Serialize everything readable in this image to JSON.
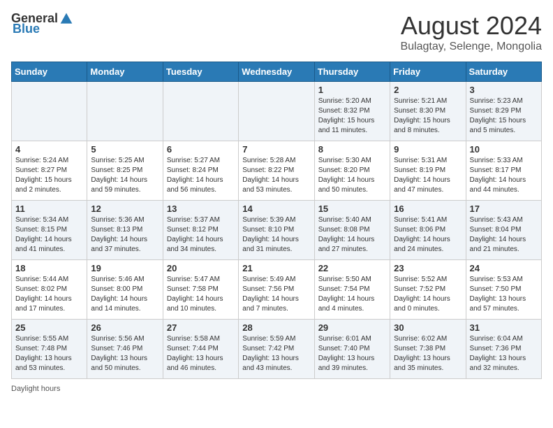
{
  "logo": {
    "general": "General",
    "blue": "Blue"
  },
  "header": {
    "month_year": "August 2024",
    "location": "Bulagtay, Selenge, Mongolia"
  },
  "days_of_week": [
    "Sunday",
    "Monday",
    "Tuesday",
    "Wednesday",
    "Thursday",
    "Friday",
    "Saturday"
  ],
  "footer": {
    "note": "Daylight hours"
  },
  "weeks": [
    {
      "days": [
        {
          "num": "",
          "info": ""
        },
        {
          "num": "",
          "info": ""
        },
        {
          "num": "",
          "info": ""
        },
        {
          "num": "",
          "info": ""
        },
        {
          "num": "1",
          "info": "Sunrise: 5:20 AM\nSunset: 8:32 PM\nDaylight: 15 hours\nand 11 minutes."
        },
        {
          "num": "2",
          "info": "Sunrise: 5:21 AM\nSunset: 8:30 PM\nDaylight: 15 hours\nand 8 minutes."
        },
        {
          "num": "3",
          "info": "Sunrise: 5:23 AM\nSunset: 8:29 PM\nDaylight: 15 hours\nand 5 minutes."
        }
      ]
    },
    {
      "days": [
        {
          "num": "4",
          "info": "Sunrise: 5:24 AM\nSunset: 8:27 PM\nDaylight: 15 hours\nand 2 minutes."
        },
        {
          "num": "5",
          "info": "Sunrise: 5:25 AM\nSunset: 8:25 PM\nDaylight: 14 hours\nand 59 minutes."
        },
        {
          "num": "6",
          "info": "Sunrise: 5:27 AM\nSunset: 8:24 PM\nDaylight: 14 hours\nand 56 minutes."
        },
        {
          "num": "7",
          "info": "Sunrise: 5:28 AM\nSunset: 8:22 PM\nDaylight: 14 hours\nand 53 minutes."
        },
        {
          "num": "8",
          "info": "Sunrise: 5:30 AM\nSunset: 8:20 PM\nDaylight: 14 hours\nand 50 minutes."
        },
        {
          "num": "9",
          "info": "Sunrise: 5:31 AM\nSunset: 8:19 PM\nDaylight: 14 hours\nand 47 minutes."
        },
        {
          "num": "10",
          "info": "Sunrise: 5:33 AM\nSunset: 8:17 PM\nDaylight: 14 hours\nand 44 minutes."
        }
      ]
    },
    {
      "days": [
        {
          "num": "11",
          "info": "Sunrise: 5:34 AM\nSunset: 8:15 PM\nDaylight: 14 hours\nand 41 minutes."
        },
        {
          "num": "12",
          "info": "Sunrise: 5:36 AM\nSunset: 8:13 PM\nDaylight: 14 hours\nand 37 minutes."
        },
        {
          "num": "13",
          "info": "Sunrise: 5:37 AM\nSunset: 8:12 PM\nDaylight: 14 hours\nand 34 minutes."
        },
        {
          "num": "14",
          "info": "Sunrise: 5:39 AM\nSunset: 8:10 PM\nDaylight: 14 hours\nand 31 minutes."
        },
        {
          "num": "15",
          "info": "Sunrise: 5:40 AM\nSunset: 8:08 PM\nDaylight: 14 hours\nand 27 minutes."
        },
        {
          "num": "16",
          "info": "Sunrise: 5:41 AM\nSunset: 8:06 PM\nDaylight: 14 hours\nand 24 minutes."
        },
        {
          "num": "17",
          "info": "Sunrise: 5:43 AM\nSunset: 8:04 PM\nDaylight: 14 hours\nand 21 minutes."
        }
      ]
    },
    {
      "days": [
        {
          "num": "18",
          "info": "Sunrise: 5:44 AM\nSunset: 8:02 PM\nDaylight: 14 hours\nand 17 minutes."
        },
        {
          "num": "19",
          "info": "Sunrise: 5:46 AM\nSunset: 8:00 PM\nDaylight: 14 hours\nand 14 minutes."
        },
        {
          "num": "20",
          "info": "Sunrise: 5:47 AM\nSunset: 7:58 PM\nDaylight: 14 hours\nand 10 minutes."
        },
        {
          "num": "21",
          "info": "Sunrise: 5:49 AM\nSunset: 7:56 PM\nDaylight: 14 hours\nand 7 minutes."
        },
        {
          "num": "22",
          "info": "Sunrise: 5:50 AM\nSunset: 7:54 PM\nDaylight: 14 hours\nand 4 minutes."
        },
        {
          "num": "23",
          "info": "Sunrise: 5:52 AM\nSunset: 7:52 PM\nDaylight: 14 hours\nand 0 minutes."
        },
        {
          "num": "24",
          "info": "Sunrise: 5:53 AM\nSunset: 7:50 PM\nDaylight: 13 hours\nand 57 minutes."
        }
      ]
    },
    {
      "days": [
        {
          "num": "25",
          "info": "Sunrise: 5:55 AM\nSunset: 7:48 PM\nDaylight: 13 hours\nand 53 minutes."
        },
        {
          "num": "26",
          "info": "Sunrise: 5:56 AM\nSunset: 7:46 PM\nDaylight: 13 hours\nand 50 minutes."
        },
        {
          "num": "27",
          "info": "Sunrise: 5:58 AM\nSunset: 7:44 PM\nDaylight: 13 hours\nand 46 minutes."
        },
        {
          "num": "28",
          "info": "Sunrise: 5:59 AM\nSunset: 7:42 PM\nDaylight: 13 hours\nand 43 minutes."
        },
        {
          "num": "29",
          "info": "Sunrise: 6:01 AM\nSunset: 7:40 PM\nDaylight: 13 hours\nand 39 minutes."
        },
        {
          "num": "30",
          "info": "Sunrise: 6:02 AM\nSunset: 7:38 PM\nDaylight: 13 hours\nand 35 minutes."
        },
        {
          "num": "31",
          "info": "Sunrise: 6:04 AM\nSunset: 7:36 PM\nDaylight: 13 hours\nand 32 minutes."
        }
      ]
    }
  ]
}
